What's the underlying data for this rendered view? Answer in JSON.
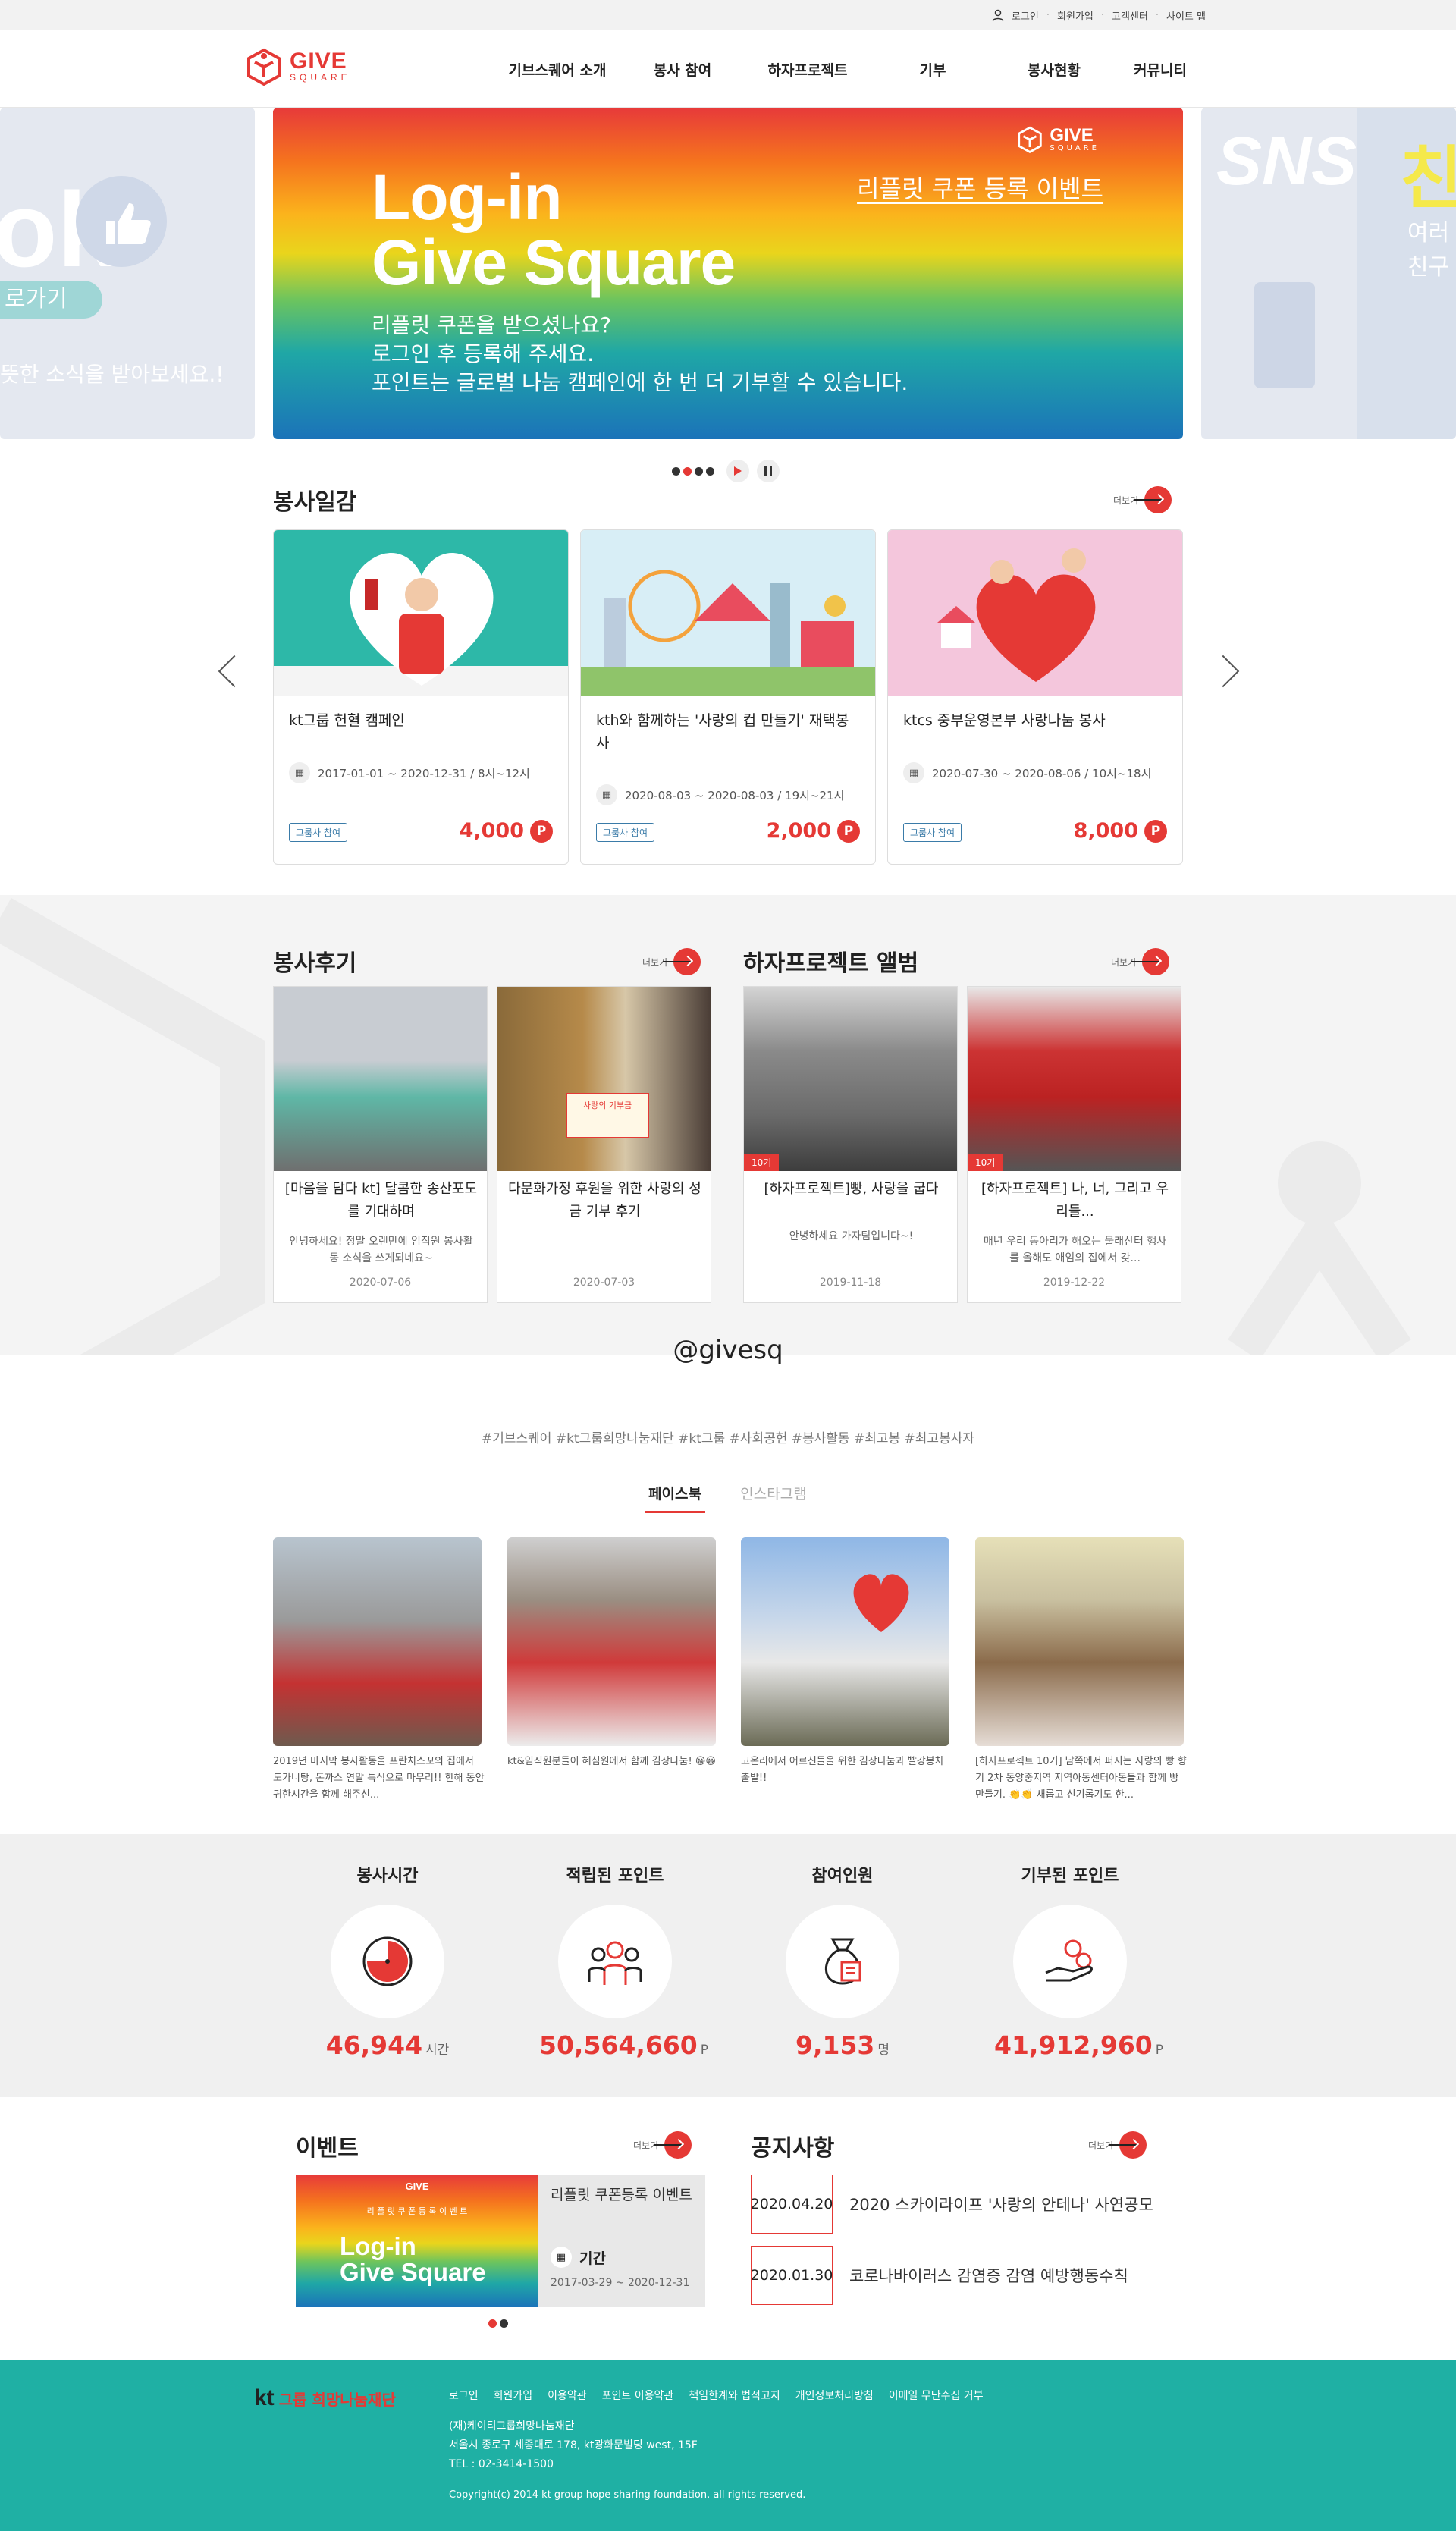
{
  "util": {
    "login": "로그인",
    "signup": "회원가입",
    "support": "고객센터",
    "sitemap": "사이트 맵"
  },
  "logo": {
    "main": "GIVE",
    "sub": "SQUARE"
  },
  "nav": [
    "기브스퀘어 소개",
    "봉사 참여",
    "하자프로젝트",
    "기부",
    "봉사현황",
    "커뮤니티"
  ],
  "banner": {
    "title1": "Log-in",
    "title2": "Give Square",
    "event": "리플릿 쿠폰 등록 이벤트",
    "line1": "리플릿 쿠폰을 받으셨나요?",
    "line2": "로그인 후 등록해 주세요.",
    "line3": "포인트는 글로벌 나눔 캠페인에 한 번 더 기부할 수 있습니다.",
    "left_big": "ok",
    "left_btn": "로가기",
    "left_text": "뜻한 소식을 받아보세요.!",
    "right_big": "SNS",
    "right_char": "친",
    "right_t1": "여러",
    "right_t2": "친구"
  },
  "volunteer": {
    "title": "봉사일감",
    "more": "더보기",
    "cards": [
      {
        "title": "kt그룹 헌혈 캠페인",
        "date": "2017-01-01 ~ 2020-12-31 / 8시~12시",
        "tag": "그룹사 참여",
        "points": "4,000"
      },
      {
        "title": "kth와 함께하는 '사랑의 컵 만들기' 재택봉사",
        "date": "2020-08-03 ~ 2020-08-03 / 19시~21시",
        "tag": "그룹사 참여",
        "points": "2,000"
      },
      {
        "title": "ktcs 중부운영본부 사랑나눔 봉사",
        "date": "2020-07-30 ~ 2020-08-06 / 10시~18시",
        "tag": "그룹사 참여",
        "points": "8,000"
      }
    ]
  },
  "reviews": {
    "title": "봉사후기",
    "more": "더보기",
    "cards": [
      {
        "title": "[마음을 담다 kt] 달콤한 송산포도를 기대하며",
        "desc": "안녕하세요! 정말 오랜만에 임직원 봉사활동 소식을 쓰게되네요~",
        "date": "2020-07-06"
      },
      {
        "title": "다문화가정 후원을 위한 사랑의 성금 기부 후기",
        "desc": "",
        "date": "2020-07-03",
        "sign": "사랑의 기부금"
      }
    ]
  },
  "album": {
    "title": "하자프로젝트 앨범",
    "more": "더보기",
    "cards": [
      {
        "title": "[하자프로젝트]빵, 사랑을 굽다",
        "desc": "안녕하세요 가자팀입니다~!",
        "date": "2019-11-18",
        "tag": "10기"
      },
      {
        "title": "[하자프로젝트] 나, 너, 그리고 우리들...",
        "desc": "매년 우리 동아리가 해오는 물래산터 행사를 올해도 애임의 집에서 갖...",
        "date": "2019-12-22",
        "tag": "10기"
      }
    ]
  },
  "sns": {
    "handle": "@givesq",
    "tags": "#기브스퀘어 #kt그룹희망나눔재단 #kt그룹 #사회공헌 #봉사활동 #최고봉 #최고봉사자",
    "tab1": "페이스북",
    "tab2": "인스타그램",
    "posts": [
      "2019년 마지막 봉사활동을 프란치스꼬의 집에서 도가니탕, 돈까스 연말 특식으로 마무리!! 한해 동안 귀한시간을 함께 해주신...",
      "kt&임직원분들이 혜심원에서 함께 김장나눔! 😀😀",
      "고온리에서 어르신들을 위한 김장나눔과 빨강봉차 출발!!",
      "[하자프로젝트 10기] 남쪽에서 퍼지는 사랑의 빵 향기 2차 동양중지역 지역아동센터아동들과 함께 빵만들기. 👏👏 새롭고 신기롭기도 한..."
    ]
  },
  "stats": [
    {
      "label": "봉사시간",
      "value": "46,944",
      "unit": "시간",
      "icon": "clock-icon"
    },
    {
      "label": "적립된 포인트",
      "value": "50,564,660",
      "unit": "P",
      "icon": "people-icon"
    },
    {
      "label": "참여인원",
      "value": "9,153",
      "unit": "명",
      "icon": "bag-icon"
    },
    {
      "label": "기부된 포인트",
      "value": "41,912,960",
      "unit": "P",
      "icon": "donate-icon"
    }
  ],
  "event": {
    "title": "이벤트",
    "more": "더보기",
    "card_title": "리플릿 쿠폰등록 이벤트",
    "period_label": "기간",
    "period": "2017-03-29 ~ 2020-12-31",
    "img_sub": "리 플 릿 쿠 폰 등 록 이 벤 트",
    "img_t1": "Log-in",
    "img_t2": "Give Square"
  },
  "notice": {
    "title": "공지사항",
    "more": "더보기",
    "items": [
      {
        "date": "2020.04.20",
        "title": "2020 스카이라이프 '사랑의 안테나' 사연공모"
      },
      {
        "date": "2020.01.30",
        "title": "코로나바이러스 감염증 감염 예방행동수칙"
      }
    ]
  },
  "footer": {
    "brand_kt": "kt",
    "brand": "그룹 희망나눔재단",
    "links": [
      "로그인",
      "회원가입",
      "이용약관",
      "포인트 이용약관",
      "책임한계와 법적고지",
      "개인정보처리방침",
      "이메일 무단수집 거부"
    ],
    "org": "(재)케이티그룹희망나눔재단",
    "addr": "서울시 종로구 세종대로 178, kt광화문빌딩 west, 15F",
    "tel": "TEL : 02-3414-1500",
    "copy": "Copyright(c) 2014 kt group hope sharing foundation. all rights reserved."
  },
  "colors": {
    "accent": "#e53935",
    "teal": "#1fb0a4"
  }
}
